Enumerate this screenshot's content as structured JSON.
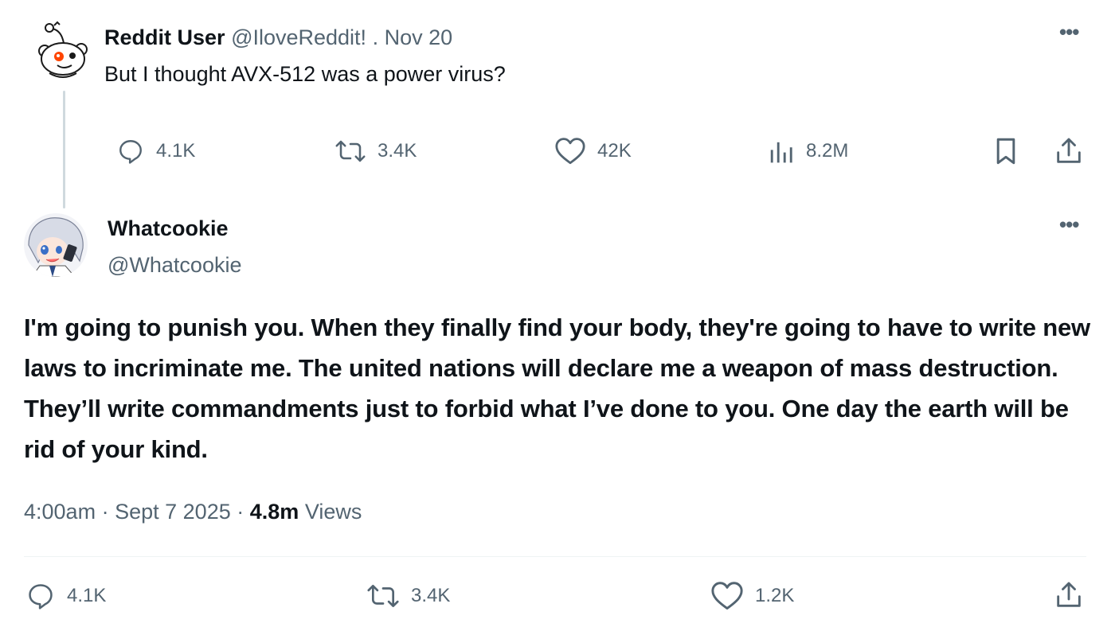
{
  "parent_tweet": {
    "display_name": "Reddit User",
    "handle": "@IloveReddit!",
    "separator": ".",
    "date": "Nov 20",
    "text": "But I thought AVX-512 was a power virus?",
    "more_icon": "ellipsis-icon",
    "actions": {
      "replies": "4.1K",
      "reposts": "3.4K",
      "likes": "42K",
      "views": "8.2M"
    }
  },
  "main_tweet": {
    "display_name": "Whatcookie",
    "handle": "@Whatcookie",
    "text": "I'm going to punish you. When they finally find your body, they're going to have to write new laws to incriminate me. The united nations will declare me a weapon of mass destruction. They’ll write commandments just to forbid what I’ve done to you. One day the earth will be rid of your kind.",
    "time": "4:00am",
    "date": "Sept 7 2025",
    "views_count": "4.8m",
    "views_label": "Views",
    "meta_separator": "·",
    "actions": {
      "replies": "4.1K",
      "reposts": "3.4K",
      "likes": "1.2K"
    }
  },
  "colors": {
    "text_primary": "#0f1419",
    "text_secondary": "#536471",
    "divider": "#eff3f4",
    "thread_line": "#cfd9de",
    "reddit_orange": "#ff4500"
  }
}
